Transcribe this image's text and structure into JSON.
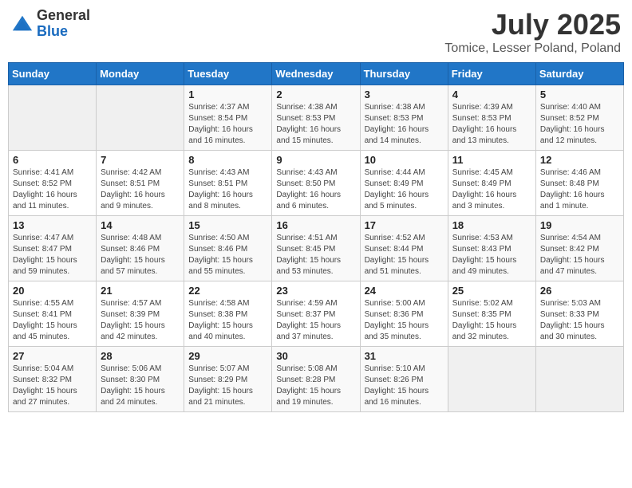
{
  "logo": {
    "general": "General",
    "blue": "Blue"
  },
  "title": {
    "month_year": "July 2025",
    "location": "Tomice, Lesser Poland, Poland"
  },
  "weekdays": [
    "Sunday",
    "Monday",
    "Tuesday",
    "Wednesday",
    "Thursday",
    "Friday",
    "Saturday"
  ],
  "weeks": [
    [
      {
        "day": "",
        "sunrise": "",
        "sunset": "",
        "daylight": ""
      },
      {
        "day": "",
        "sunrise": "",
        "sunset": "",
        "daylight": ""
      },
      {
        "day": "1",
        "sunrise": "Sunrise: 4:37 AM",
        "sunset": "Sunset: 8:54 PM",
        "daylight": "Daylight: 16 hours and 16 minutes."
      },
      {
        "day": "2",
        "sunrise": "Sunrise: 4:38 AM",
        "sunset": "Sunset: 8:53 PM",
        "daylight": "Daylight: 16 hours and 15 minutes."
      },
      {
        "day": "3",
        "sunrise": "Sunrise: 4:38 AM",
        "sunset": "Sunset: 8:53 PM",
        "daylight": "Daylight: 16 hours and 14 minutes."
      },
      {
        "day": "4",
        "sunrise": "Sunrise: 4:39 AM",
        "sunset": "Sunset: 8:53 PM",
        "daylight": "Daylight: 16 hours and 13 minutes."
      },
      {
        "day": "5",
        "sunrise": "Sunrise: 4:40 AM",
        "sunset": "Sunset: 8:52 PM",
        "daylight": "Daylight: 16 hours and 12 minutes."
      }
    ],
    [
      {
        "day": "6",
        "sunrise": "Sunrise: 4:41 AM",
        "sunset": "Sunset: 8:52 PM",
        "daylight": "Daylight: 16 hours and 11 minutes."
      },
      {
        "day": "7",
        "sunrise": "Sunrise: 4:42 AM",
        "sunset": "Sunset: 8:51 PM",
        "daylight": "Daylight: 16 hours and 9 minutes."
      },
      {
        "day": "8",
        "sunrise": "Sunrise: 4:43 AM",
        "sunset": "Sunset: 8:51 PM",
        "daylight": "Daylight: 16 hours and 8 minutes."
      },
      {
        "day": "9",
        "sunrise": "Sunrise: 4:43 AM",
        "sunset": "Sunset: 8:50 PM",
        "daylight": "Daylight: 16 hours and 6 minutes."
      },
      {
        "day": "10",
        "sunrise": "Sunrise: 4:44 AM",
        "sunset": "Sunset: 8:49 PM",
        "daylight": "Daylight: 16 hours and 5 minutes."
      },
      {
        "day": "11",
        "sunrise": "Sunrise: 4:45 AM",
        "sunset": "Sunset: 8:49 PM",
        "daylight": "Daylight: 16 hours and 3 minutes."
      },
      {
        "day": "12",
        "sunrise": "Sunrise: 4:46 AM",
        "sunset": "Sunset: 8:48 PM",
        "daylight": "Daylight: 16 hours and 1 minute."
      }
    ],
    [
      {
        "day": "13",
        "sunrise": "Sunrise: 4:47 AM",
        "sunset": "Sunset: 8:47 PM",
        "daylight": "Daylight: 15 hours and 59 minutes."
      },
      {
        "day": "14",
        "sunrise": "Sunrise: 4:48 AM",
        "sunset": "Sunset: 8:46 PM",
        "daylight": "Daylight: 15 hours and 57 minutes."
      },
      {
        "day": "15",
        "sunrise": "Sunrise: 4:50 AM",
        "sunset": "Sunset: 8:46 PM",
        "daylight": "Daylight: 15 hours and 55 minutes."
      },
      {
        "day": "16",
        "sunrise": "Sunrise: 4:51 AM",
        "sunset": "Sunset: 8:45 PM",
        "daylight": "Daylight: 15 hours and 53 minutes."
      },
      {
        "day": "17",
        "sunrise": "Sunrise: 4:52 AM",
        "sunset": "Sunset: 8:44 PM",
        "daylight": "Daylight: 15 hours and 51 minutes."
      },
      {
        "day": "18",
        "sunrise": "Sunrise: 4:53 AM",
        "sunset": "Sunset: 8:43 PM",
        "daylight": "Daylight: 15 hours and 49 minutes."
      },
      {
        "day": "19",
        "sunrise": "Sunrise: 4:54 AM",
        "sunset": "Sunset: 8:42 PM",
        "daylight": "Daylight: 15 hours and 47 minutes."
      }
    ],
    [
      {
        "day": "20",
        "sunrise": "Sunrise: 4:55 AM",
        "sunset": "Sunset: 8:41 PM",
        "daylight": "Daylight: 15 hours and 45 minutes."
      },
      {
        "day": "21",
        "sunrise": "Sunrise: 4:57 AM",
        "sunset": "Sunset: 8:39 PM",
        "daylight": "Daylight: 15 hours and 42 minutes."
      },
      {
        "day": "22",
        "sunrise": "Sunrise: 4:58 AM",
        "sunset": "Sunset: 8:38 PM",
        "daylight": "Daylight: 15 hours and 40 minutes."
      },
      {
        "day": "23",
        "sunrise": "Sunrise: 4:59 AM",
        "sunset": "Sunset: 8:37 PM",
        "daylight": "Daylight: 15 hours and 37 minutes."
      },
      {
        "day": "24",
        "sunrise": "Sunrise: 5:00 AM",
        "sunset": "Sunset: 8:36 PM",
        "daylight": "Daylight: 15 hours and 35 minutes."
      },
      {
        "day": "25",
        "sunrise": "Sunrise: 5:02 AM",
        "sunset": "Sunset: 8:35 PM",
        "daylight": "Daylight: 15 hours and 32 minutes."
      },
      {
        "day": "26",
        "sunrise": "Sunrise: 5:03 AM",
        "sunset": "Sunset: 8:33 PM",
        "daylight": "Daylight: 15 hours and 30 minutes."
      }
    ],
    [
      {
        "day": "27",
        "sunrise": "Sunrise: 5:04 AM",
        "sunset": "Sunset: 8:32 PM",
        "daylight": "Daylight: 15 hours and 27 minutes."
      },
      {
        "day": "28",
        "sunrise": "Sunrise: 5:06 AM",
        "sunset": "Sunset: 8:30 PM",
        "daylight": "Daylight: 15 hours and 24 minutes."
      },
      {
        "day": "29",
        "sunrise": "Sunrise: 5:07 AM",
        "sunset": "Sunset: 8:29 PM",
        "daylight": "Daylight: 15 hours and 21 minutes."
      },
      {
        "day": "30",
        "sunrise": "Sunrise: 5:08 AM",
        "sunset": "Sunset: 8:28 PM",
        "daylight": "Daylight: 15 hours and 19 minutes."
      },
      {
        "day": "31",
        "sunrise": "Sunrise: 5:10 AM",
        "sunset": "Sunset: 8:26 PM",
        "daylight": "Daylight: 15 hours and 16 minutes."
      },
      {
        "day": "",
        "sunrise": "",
        "sunset": "",
        "daylight": ""
      },
      {
        "day": "",
        "sunrise": "",
        "sunset": "",
        "daylight": ""
      }
    ]
  ]
}
